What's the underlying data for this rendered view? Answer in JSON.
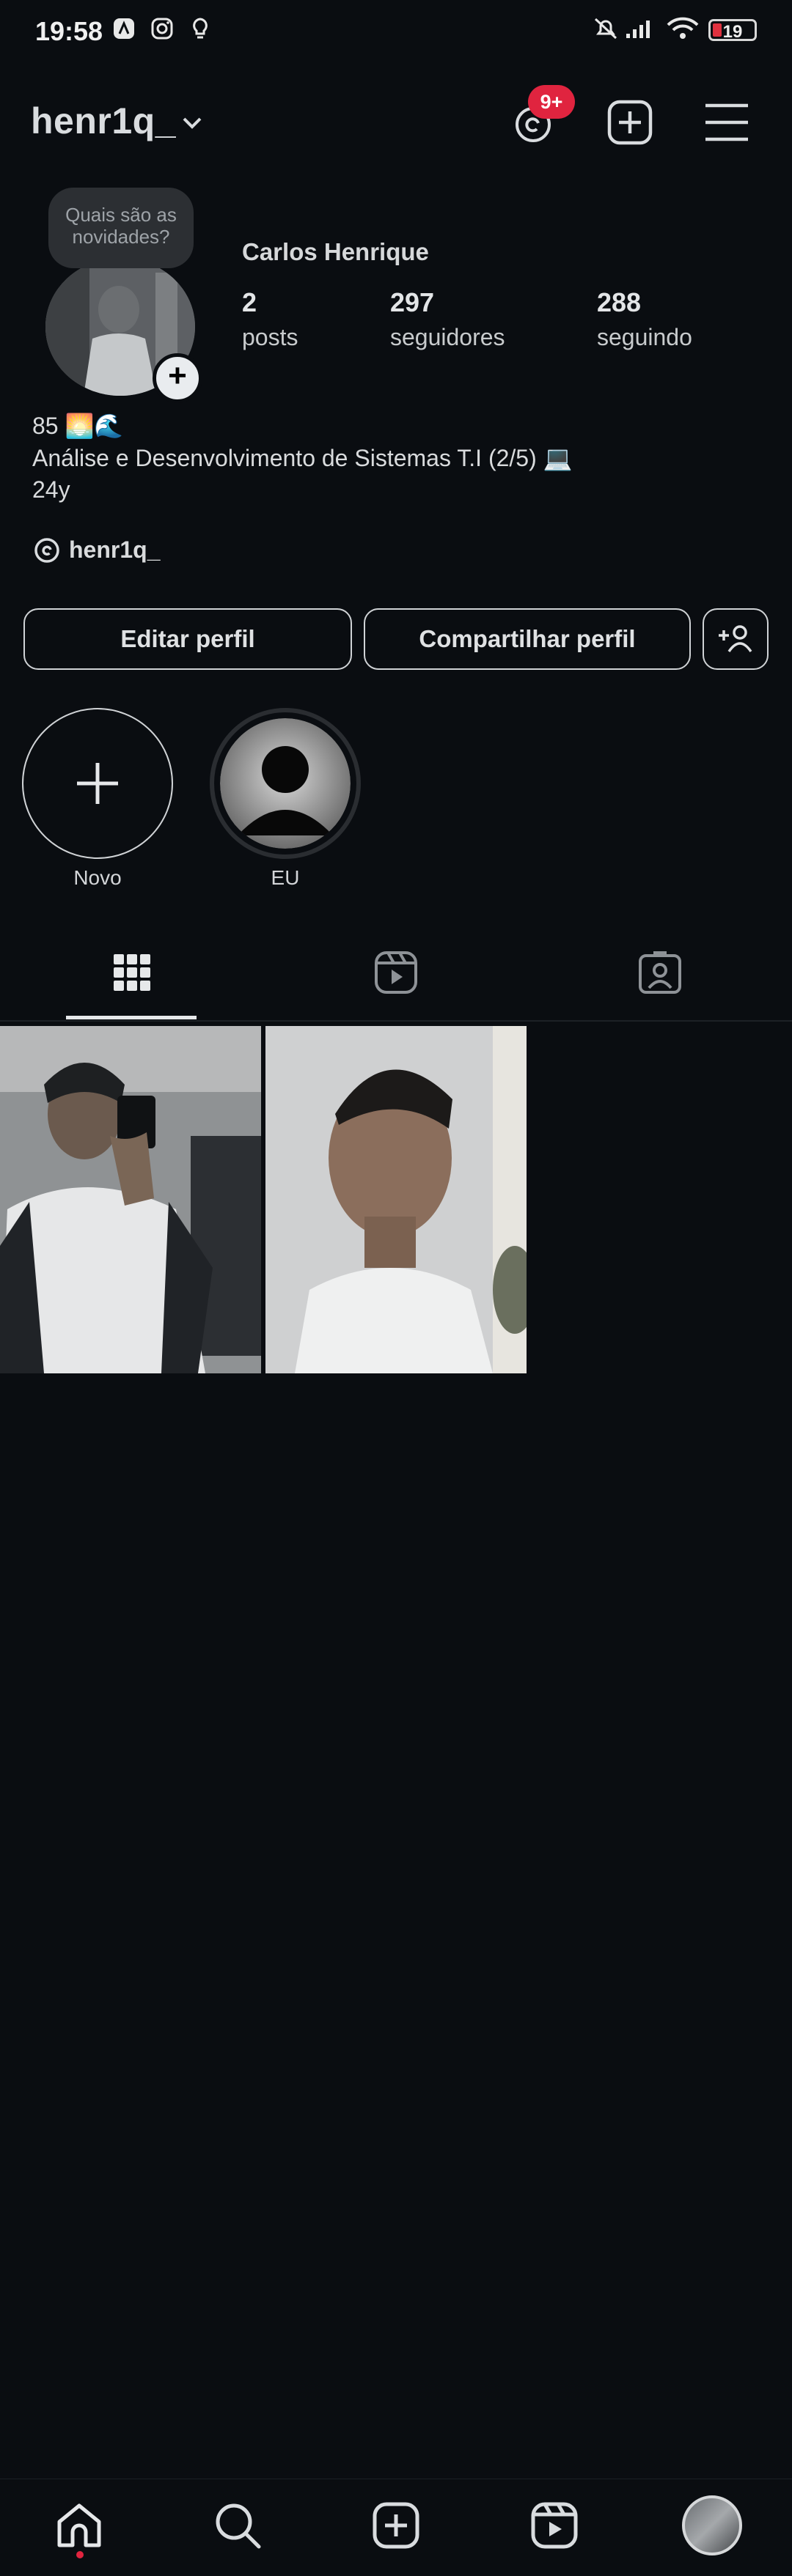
{
  "status_bar": {
    "time": "19:58",
    "battery": "19",
    "icons": [
      "app-a-icon",
      "instagram-icon",
      "lightbulb-icon",
      "mute-icon",
      "signal-icon",
      "wifi-icon"
    ]
  },
  "header": {
    "username": "henr1q_",
    "threads_badge": "9+"
  },
  "profile": {
    "note_bubble": "Quais são as novidades?",
    "full_name": "Carlos Henrique",
    "stats": {
      "posts_count": "2",
      "posts_label": "posts",
      "followers_count": "297",
      "followers_label": "seguidores",
      "following_count": "288",
      "following_label": "seguindo"
    },
    "bio_line1": "85 🌅🌊",
    "bio_line2": "Análise e Desenvolvimento de Sistemas T.I (2/5) 💻",
    "bio_line3": "24y",
    "threads_handle": "henr1q_"
  },
  "actions": {
    "edit_profile": "Editar perfil",
    "share_profile": "Compartilhar perfil"
  },
  "highlights": [
    {
      "label": "Novo"
    },
    {
      "label": "EU"
    }
  ],
  "colors": {
    "background": "#0a0d11",
    "badge": "#e0243f",
    "text": "#e6e8ea"
  }
}
